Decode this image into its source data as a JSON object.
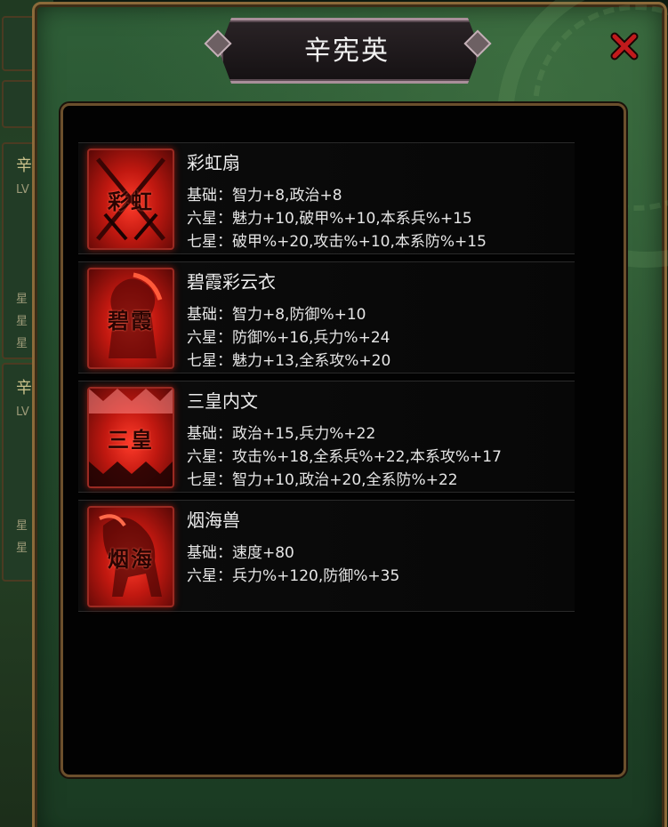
{
  "title": "辛宪英",
  "background": {
    "left_glyphs": [
      "辛",
      "辛"
    ],
    "left_small": [
      "LV",
      "星",
      "星",
      "星",
      "LV",
      "星",
      "星"
    ]
  },
  "items": [
    {
      "name": "彩虹扇",
      "icon_glyph": "彩虹",
      "icon": "fan-icon",
      "stats": [
        {
          "label": "基础：",
          "value": "智力+8,政治+8"
        },
        {
          "label": "六星：",
          "value": "魅力+10,破甲%+10,本系兵%+15"
        },
        {
          "label": "七星：",
          "value": "破甲%+20,攻击%+10,本系防%+15"
        }
      ]
    },
    {
      "name": "碧霞彩云衣",
      "icon_glyph": "碧霞",
      "icon": "robe-icon",
      "stats": [
        {
          "label": "基础：",
          "value": "智力+8,防御%+10"
        },
        {
          "label": "六星：",
          "value": "防御%+16,兵力%+24"
        },
        {
          "label": "七星：",
          "value": "魅力+13,全系攻%+20"
        }
      ]
    },
    {
      "name": "三皇内文",
      "icon_glyph": "三皇",
      "icon": "scroll-icon",
      "stats": [
        {
          "label": "基础：",
          "value": "政治+15,兵力%+22"
        },
        {
          "label": "六星：",
          "value": "攻击%+18,全系兵%+22,本系攻%+17"
        },
        {
          "label": "七星：",
          "value": "智力+10,政治+20,全系防%+22"
        }
      ]
    },
    {
      "name": "烟海兽",
      "icon_glyph": "烟海",
      "icon": "beast-mount-icon",
      "stats": [
        {
          "label": "基础：",
          "value": "速度+80"
        },
        {
          "label": "六星：",
          "value": "兵力%+120,防御%+35"
        }
      ]
    }
  ],
  "colors": {
    "frame_green": "#2f5f38",
    "panel_black": "#020202",
    "icon_red": "#c01810",
    "border_bronze": "#8b6a3a",
    "close_red": "#b0181a"
  }
}
